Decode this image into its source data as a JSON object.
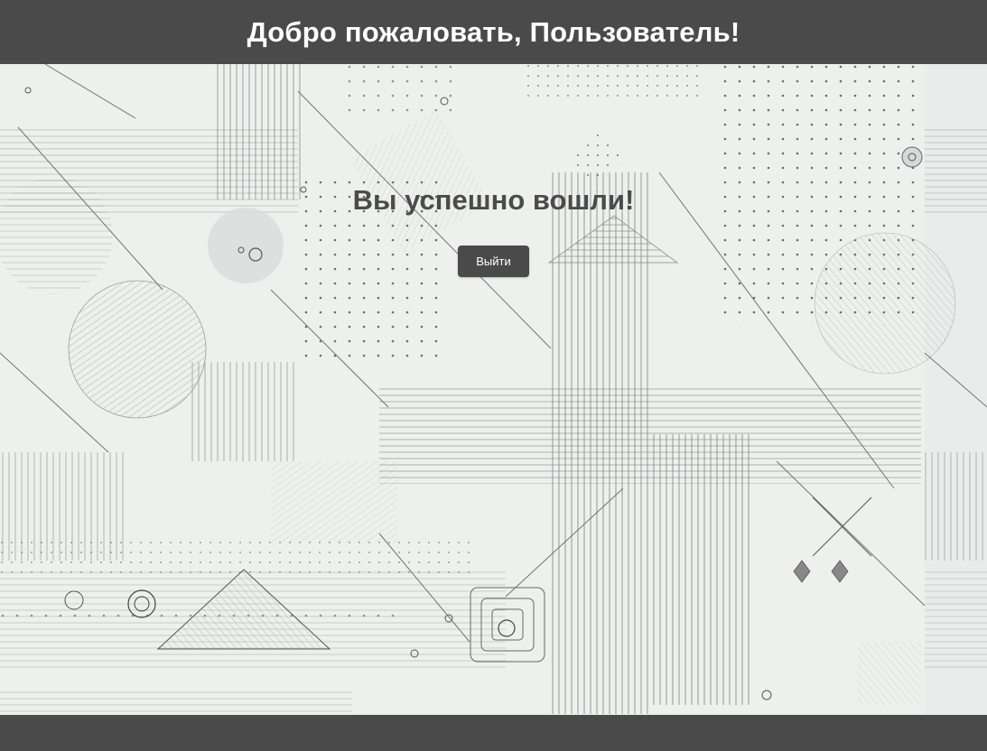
{
  "header": {
    "title": "Добро пожаловать, Пользователь!"
  },
  "main": {
    "success_message": "Вы успешно вошли!",
    "logout_label": "Выйти"
  },
  "colors": {
    "header_bg": "#4a4a4a",
    "footer_bg": "#4a4a4a",
    "button_bg": "#4a4a4a",
    "page_bg": "#eef0ed",
    "text_dark": "#4b4b4b",
    "text_light": "#ffffff"
  },
  "background": {
    "style": "abstract geometric line pattern"
  }
}
